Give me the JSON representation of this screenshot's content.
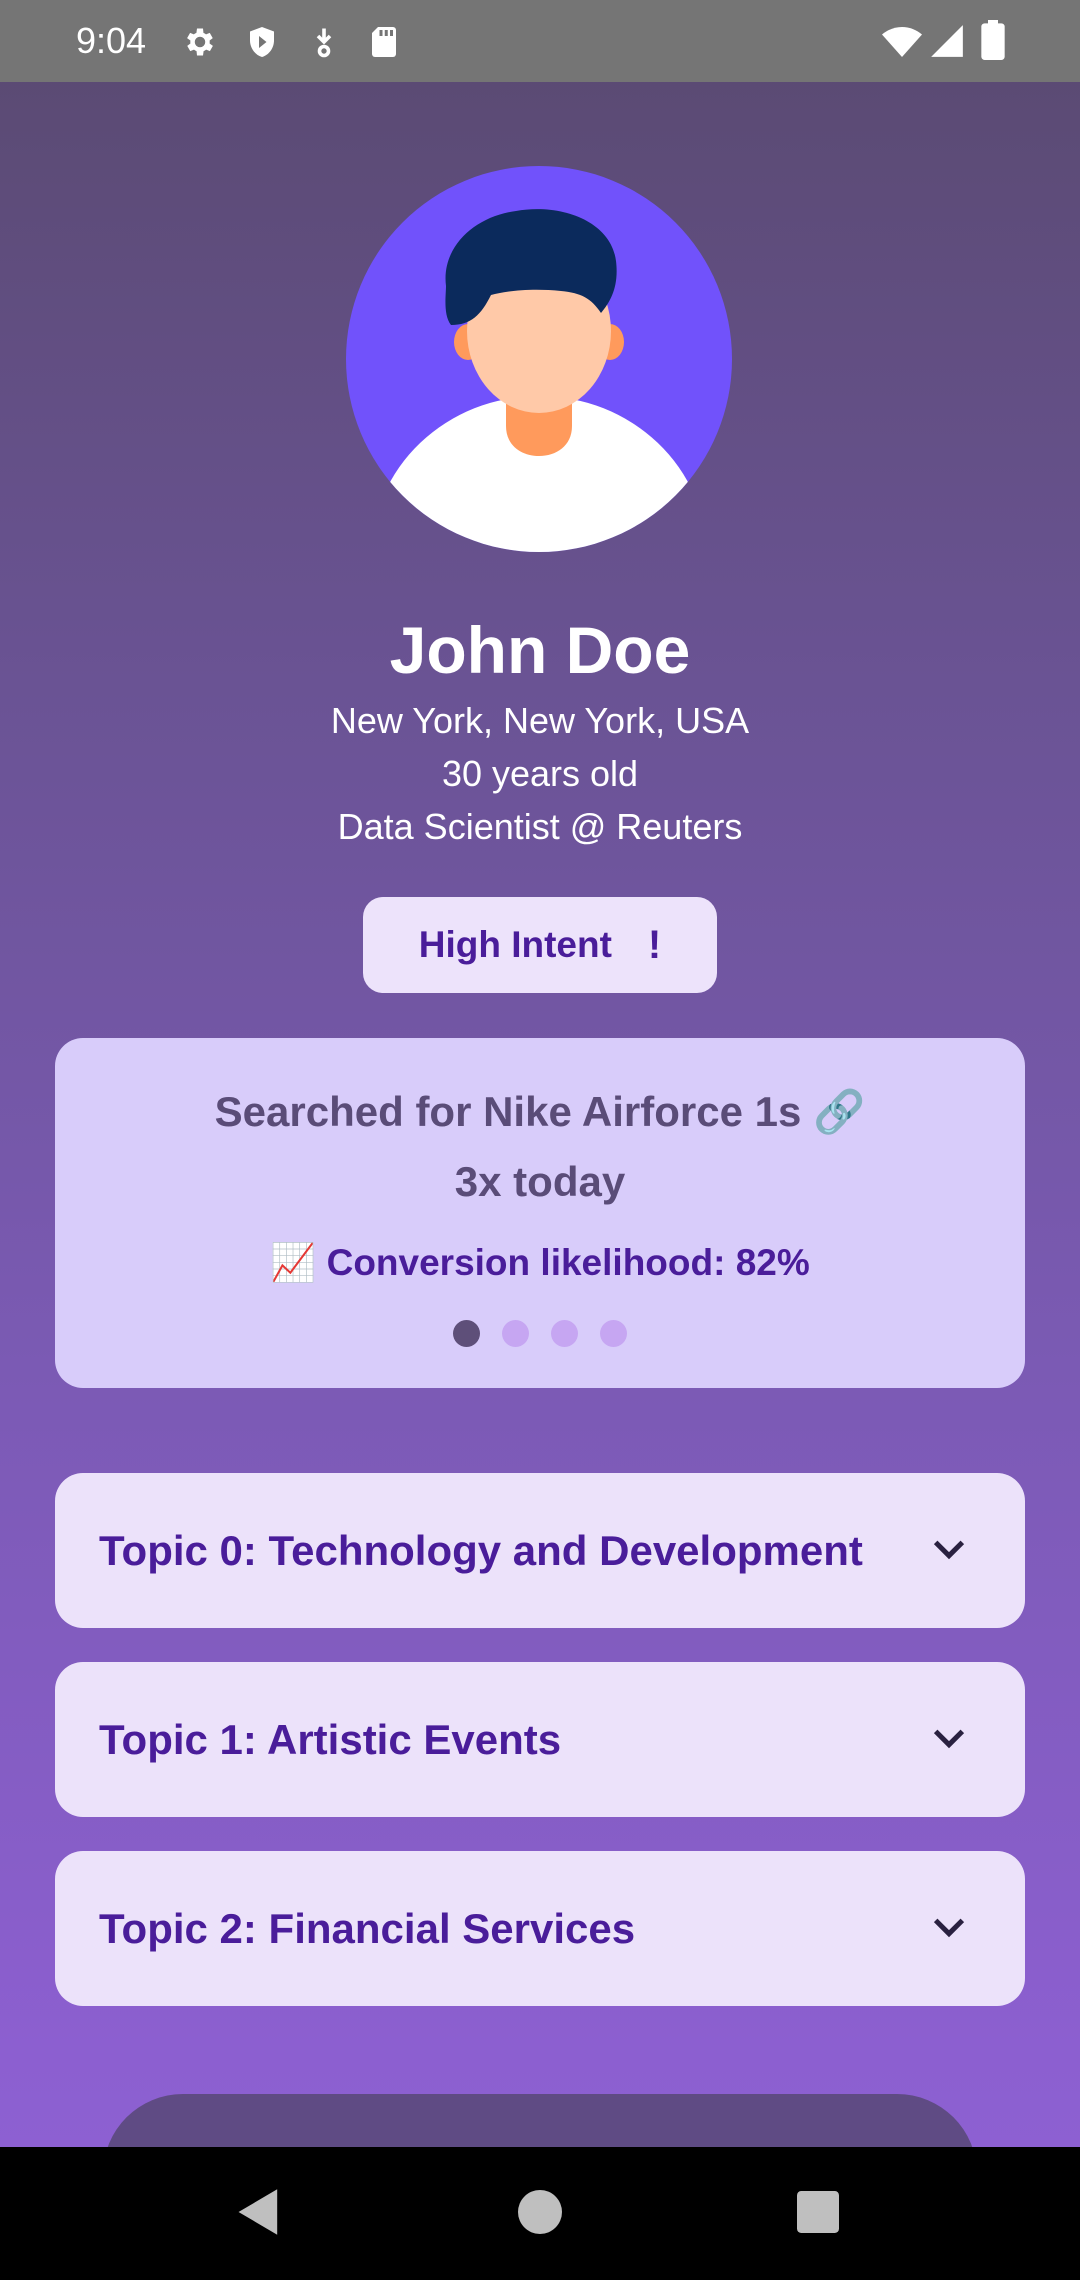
{
  "status_bar": {
    "time": "9:04",
    "icons": [
      "gear-icon",
      "shield-icon",
      "download-icon",
      "sd-card-icon",
      "wifi-icon",
      "signal-icon",
      "battery-icon"
    ]
  },
  "profile": {
    "name": "John Doe",
    "location": "New York, New York, USA",
    "age": "30 years old",
    "job": "Data Scientist @ Reuters"
  },
  "intent_button": {
    "label": "High Intent",
    "icon_text": "!"
  },
  "insight_card": {
    "line1": "Searched for Nike Airforce 1s 🔗",
    "line2": "3x today",
    "line3": "📈 Conversion likelihood: 82%",
    "page_count": 4,
    "active_page": 0
  },
  "topics": [
    {
      "label": "Topic 0: Technology and Development"
    },
    {
      "label": "Topic 1: Artistic Events"
    },
    {
      "label": "Topic 2: Financial Services"
    }
  ],
  "colors": {
    "accent": "#4a1d9a",
    "avatar_bg": "#7152fb",
    "card_bg": "#d8ccfa",
    "topic_bg": "#ece2fa"
  }
}
